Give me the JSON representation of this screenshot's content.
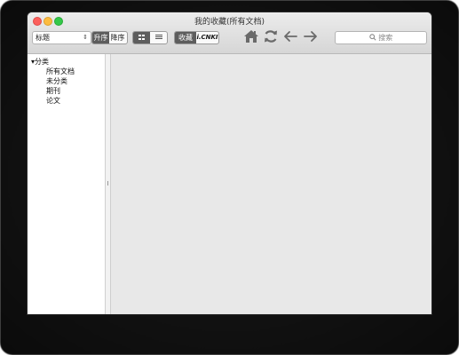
{
  "window": {
    "title": "我的收藏(所有文档)"
  },
  "toolbar": {
    "sort_field": "标题",
    "order_asc": "升序",
    "order_desc": "降序",
    "source_collect": "收藏",
    "source_cnki": "i.CNKI",
    "search_placeholder": "搜索"
  },
  "sidebar": {
    "root_label": "分类",
    "items": [
      {
        "label": "所有文档"
      },
      {
        "label": "未分类"
      },
      {
        "label": "期刊"
      },
      {
        "label": "论文"
      }
    ]
  },
  "colors": {
    "close": "#fc605c",
    "minimize": "#fdbc40",
    "maximize": "#34c84a",
    "segment_active": "#5d5d5d"
  },
  "icons": [
    "home-icon",
    "refresh-icon",
    "back-arrow-icon",
    "forward-arrow-icon",
    "search-icon",
    "grid-view-icon",
    "list-view-icon"
  ]
}
